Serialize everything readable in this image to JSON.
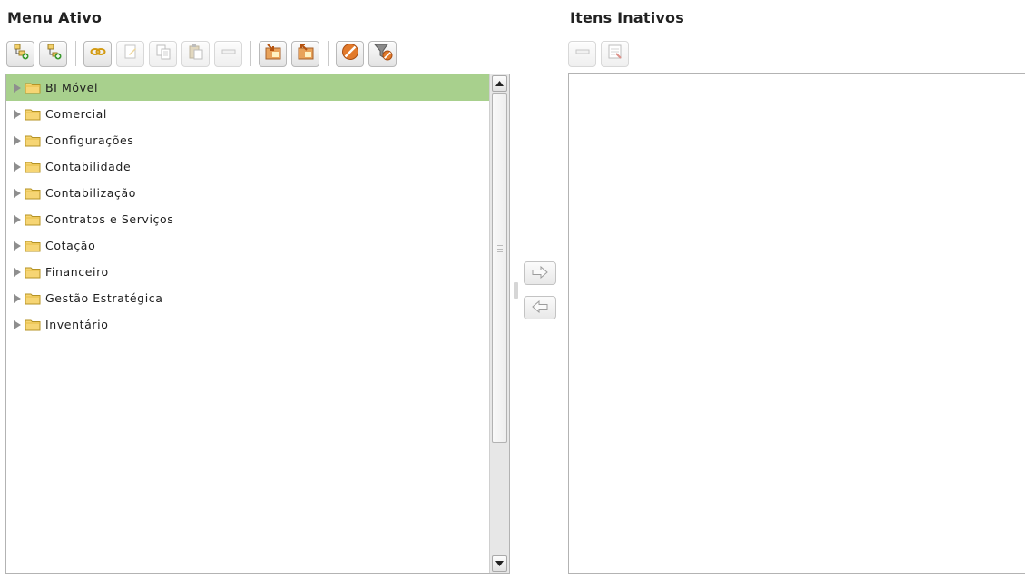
{
  "left_panel": {
    "title": "Menu Ativo",
    "toolbar": [
      {
        "icon": "add-tree-node-icon",
        "enabled": true
      },
      {
        "icon": "add-child-node-icon",
        "enabled": true
      },
      {
        "icon": "link-icon",
        "enabled": true
      },
      {
        "icon": "edit-icon",
        "enabled": false
      },
      {
        "icon": "copy-icon",
        "enabled": false
      },
      {
        "icon": "paste-icon",
        "enabled": false
      },
      {
        "icon": "remove-icon",
        "enabled": false
      },
      {
        "icon": "import-icon",
        "enabled": true
      },
      {
        "icon": "export-icon",
        "enabled": true
      },
      {
        "icon": "block-icon",
        "enabled": true
      },
      {
        "icon": "filter-remove-icon",
        "enabled": true
      }
    ],
    "tree_items": [
      {
        "label": "BI Móvel",
        "selected": true
      },
      {
        "label": "Comercial",
        "selected": false
      },
      {
        "label": "Configurações",
        "selected": false
      },
      {
        "label": "Contabilidade",
        "selected": false
      },
      {
        "label": "Contabilização",
        "selected": false
      },
      {
        "label": "Contratos e Serviços",
        "selected": false
      },
      {
        "label": "Cotação",
        "selected": false
      },
      {
        "label": "Financeiro",
        "selected": false
      },
      {
        "label": "Gestão Estratégica",
        "selected": false
      },
      {
        "label": "Inventário",
        "selected": false
      }
    ]
  },
  "right_panel": {
    "title": "Itens Inativos",
    "toolbar": [
      {
        "icon": "remove-icon",
        "enabled": false
      },
      {
        "icon": "details-icon",
        "enabled": false
      }
    ]
  },
  "transfer": {
    "move_right_icon": "arrow-right-icon",
    "move_left_icon": "arrow-left-icon"
  },
  "colors": {
    "selected_row": "#a8d08d",
    "folder": "#f6d574",
    "accent_orange": "#e27a2b"
  }
}
